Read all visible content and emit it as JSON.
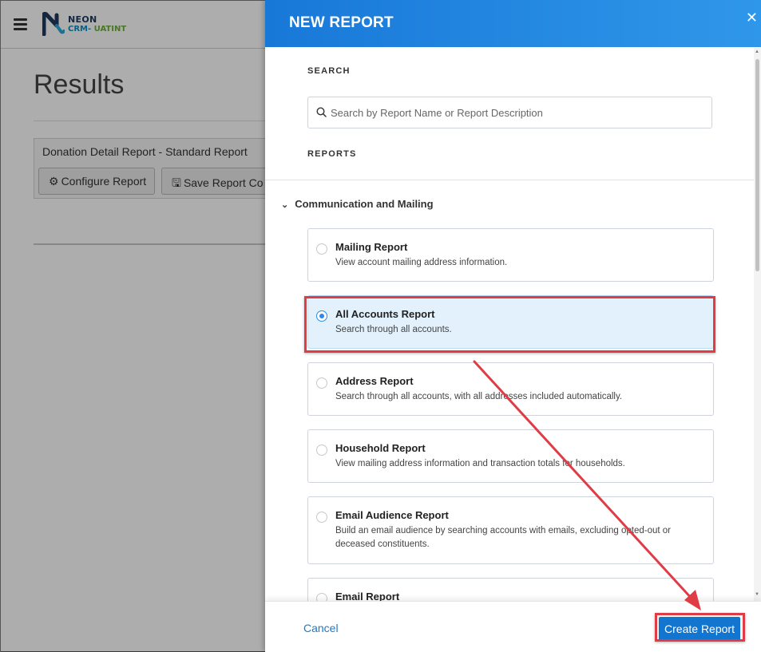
{
  "app": {
    "logo": {
      "line1": "NEON",
      "line2a": "CRM",
      "line2b": "-",
      "line2c": "UATINT"
    },
    "page_title": "Results",
    "report_panel": {
      "title": "Donation Detail Report - Standard Report",
      "configure_label": "Configure Report",
      "save_label": "Save Report Co"
    }
  },
  "drawer": {
    "title": "NEW REPORT",
    "close_glyph": "✕",
    "search_label": "SEARCH",
    "search_placeholder": "Search by Report Name or Report Description",
    "search_value": "",
    "reports_label": "REPORTS",
    "category": "Communication and Mailing",
    "reports": [
      {
        "title": "Mailing Report",
        "desc": "View account mailing address information.",
        "selected": false
      },
      {
        "title": "All Accounts Report",
        "desc": "Search through all accounts.",
        "selected": true
      },
      {
        "title": "Address Report",
        "desc": "Search through all accounts, with all addresses included automatically.",
        "selected": false
      },
      {
        "title": "Household Report",
        "desc": "View mailing address information and transaction totals for households.",
        "selected": false
      },
      {
        "title": "Email Audience Report",
        "desc": "Build an email audience by searching accounts with emails, excluding opted-out or deceased constituents.",
        "selected": false
      },
      {
        "title": "Email Report",
        "desc": "",
        "selected": false
      }
    ],
    "footer": {
      "cancel_label": "Cancel",
      "create_label": "Create Report"
    }
  },
  "colors": {
    "accent": "#1275d0",
    "header_gradient_start": "#1878d8",
    "highlight": "#e03c46",
    "selected_bg": "#e2f1fc"
  }
}
